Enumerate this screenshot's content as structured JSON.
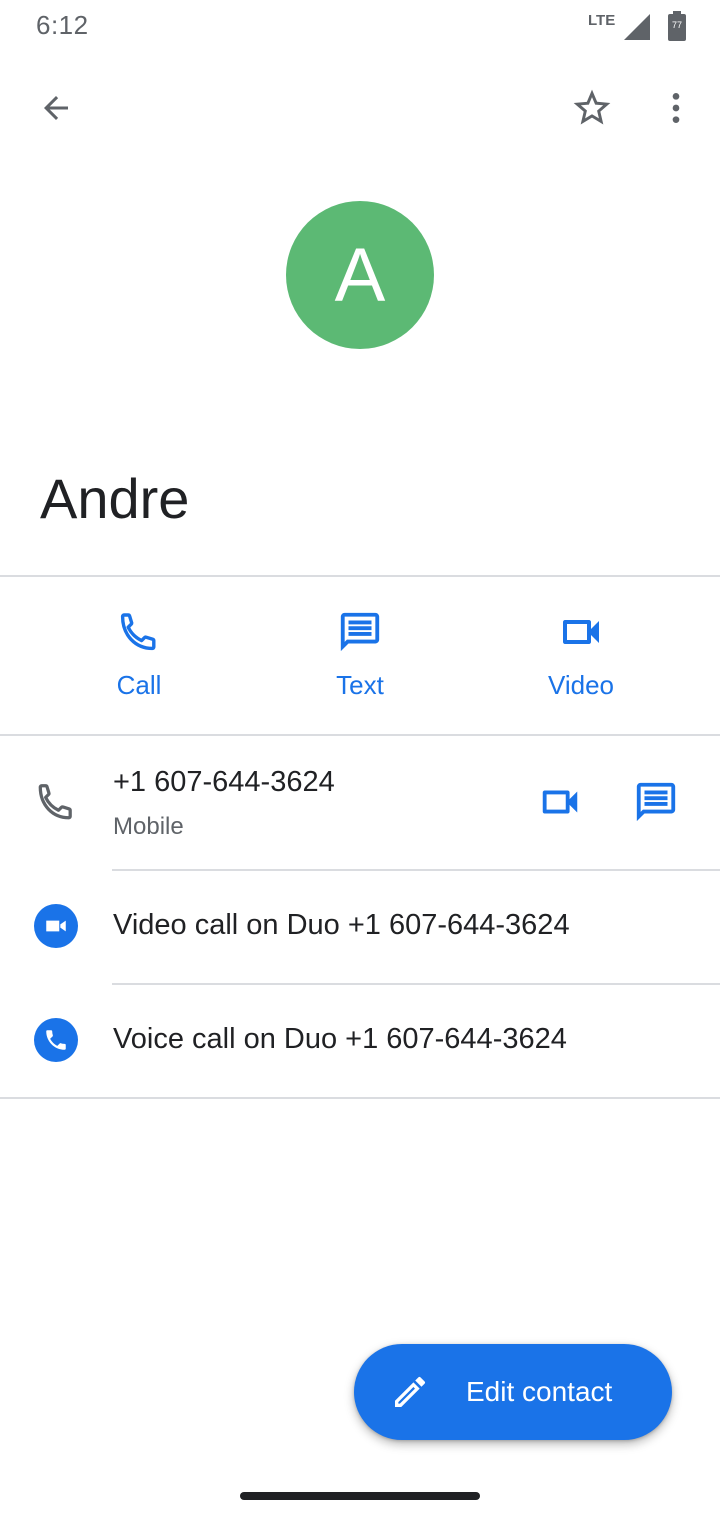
{
  "status_bar": {
    "time": "6:12",
    "network": "LTE",
    "battery_level": "77"
  },
  "toolbar": {
    "back_icon": "arrow-back-icon",
    "favorite_icon": "star-outline-icon",
    "more_icon": "more-vert-icon"
  },
  "contact": {
    "avatar_letter": "A",
    "avatar_color": "#5cb974",
    "name": "Andre"
  },
  "actions": [
    {
      "label": "Call",
      "icon": "phone-icon"
    },
    {
      "label": "Text",
      "icon": "message-icon"
    },
    {
      "label": "Video",
      "icon": "videocam-icon"
    }
  ],
  "phone": {
    "number": "+1 607-644-3624",
    "type": "Mobile"
  },
  "duo": {
    "video_call": "Video call on Duo +1 607-644-3624",
    "voice_call": "Voice call on Duo +1 607-644-3624"
  },
  "fab": {
    "label": "Edit contact",
    "icon": "pencil-icon"
  },
  "colors": {
    "accent": "#1a73e8",
    "text_primary": "#202124",
    "text_secondary": "#5f6368",
    "divider": "#dadce0"
  }
}
